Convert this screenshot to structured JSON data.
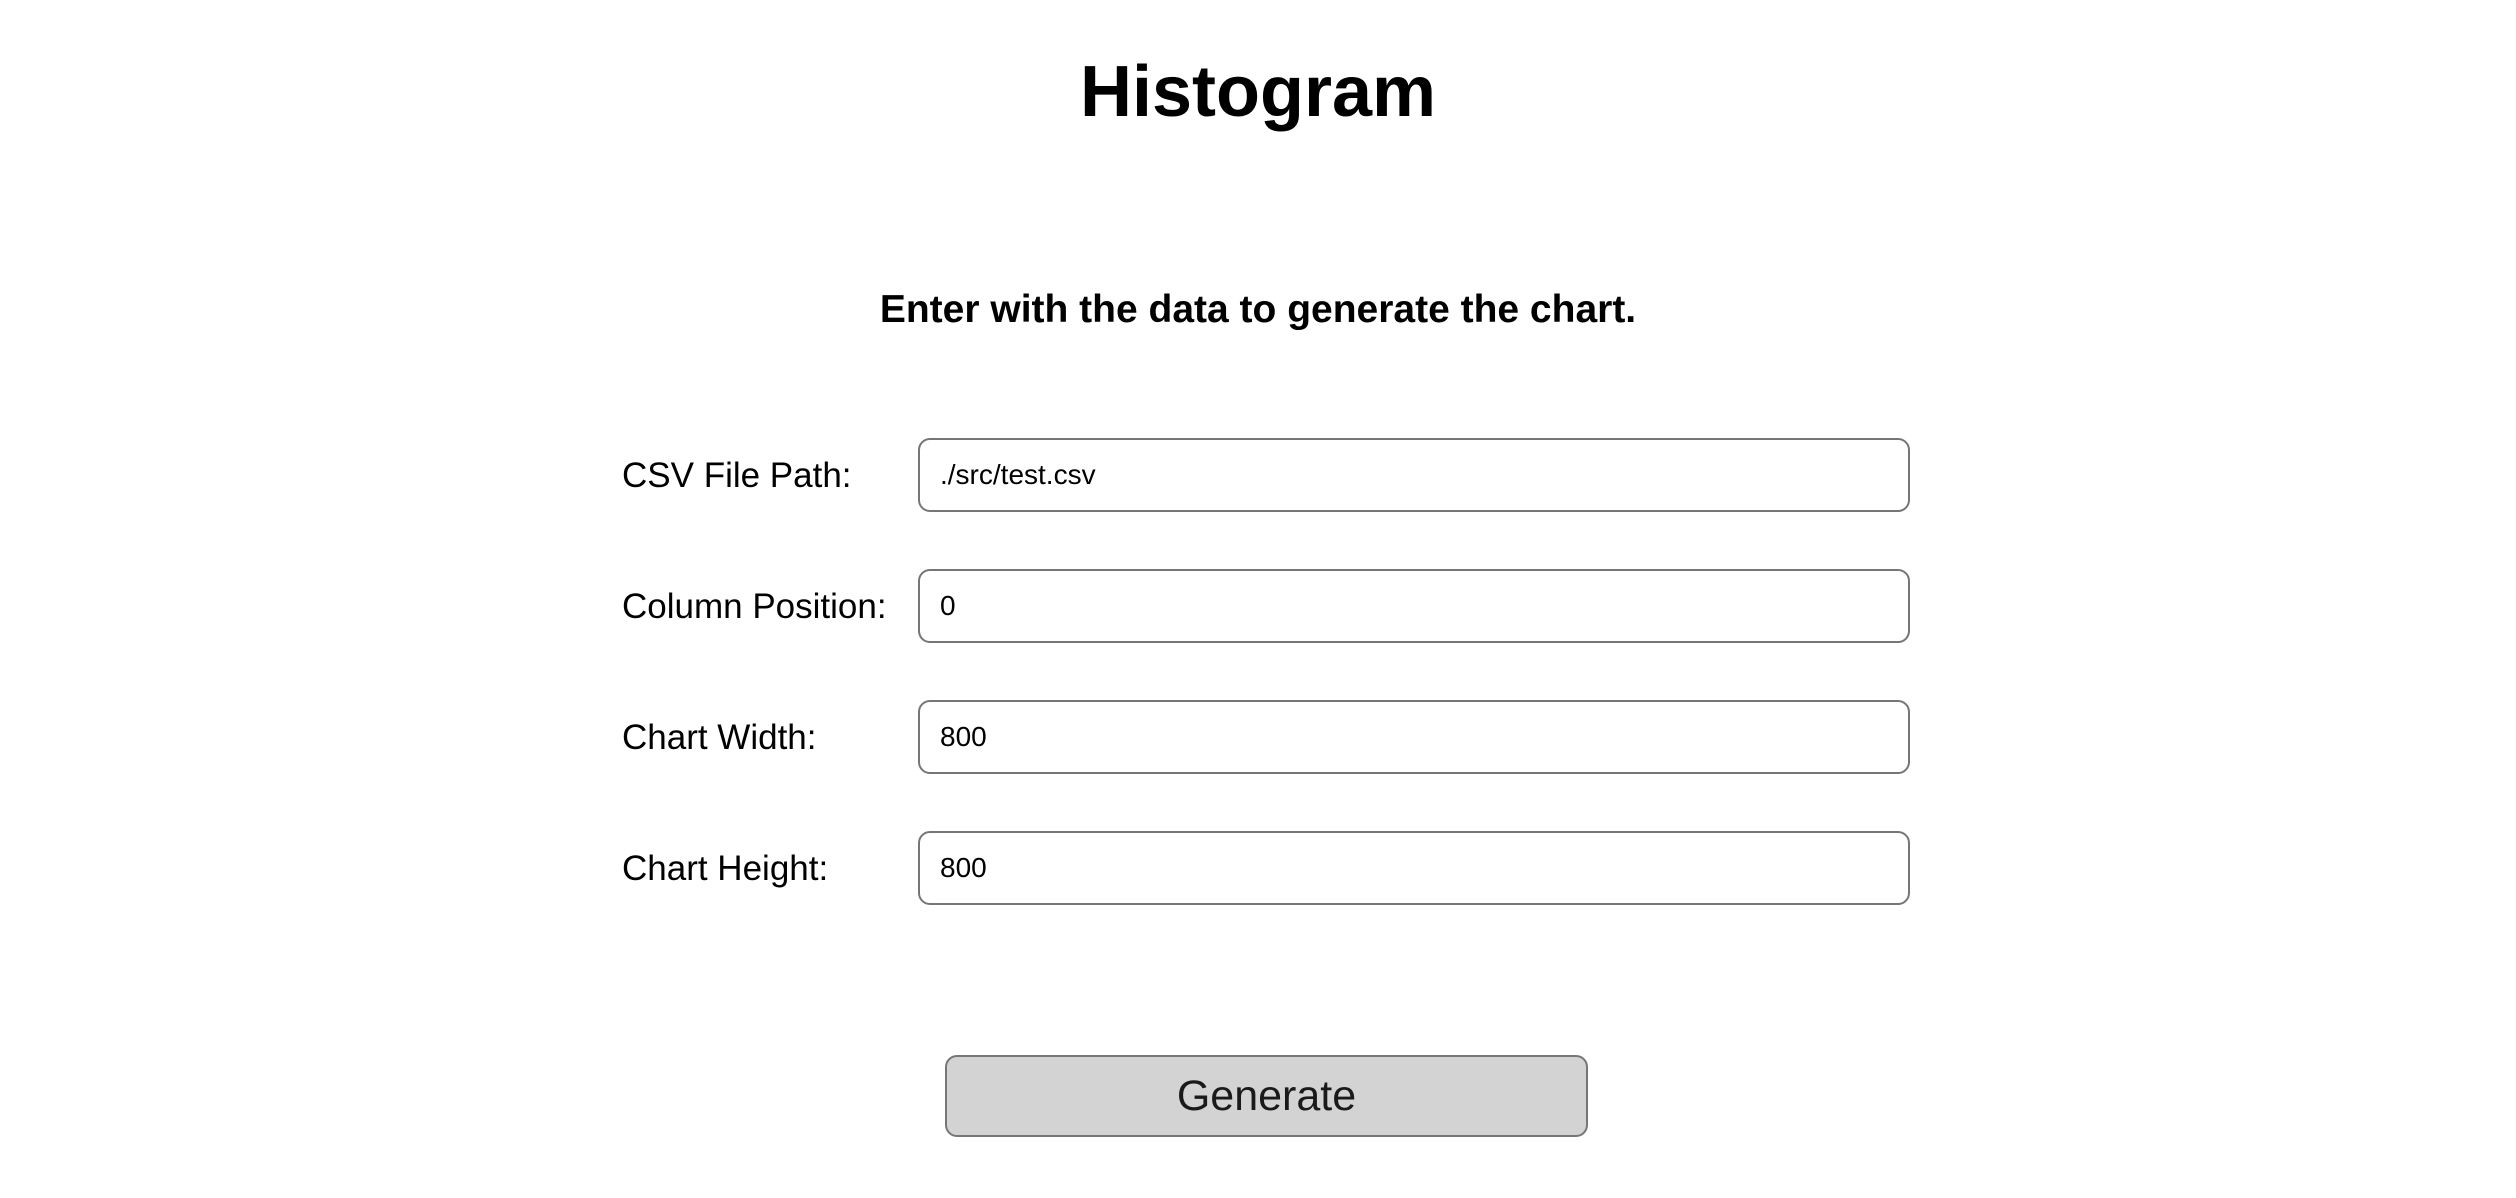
{
  "page": {
    "title": "Histogram",
    "subtitle": "Enter with the data to generate the chart."
  },
  "form": {
    "fields": [
      {
        "label": "CSV File Path:",
        "value": "./src/test.csv"
      },
      {
        "label": "Column Position:",
        "value": "0"
      },
      {
        "label": "Chart Width:",
        "value": "800"
      },
      {
        "label": "Chart Height:",
        "value": "800"
      }
    ],
    "submit_label": "Generate"
  },
  "colors": {
    "input_border": "#767676",
    "button_background": "#d3d3d3",
    "text": "#000000",
    "background": "#ffffff"
  }
}
